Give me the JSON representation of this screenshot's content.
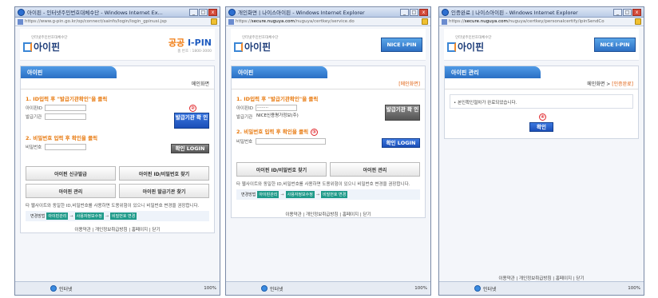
{
  "windows": [
    {
      "title": "아이핀 - 인터넷주민번호대체수단 - Windows Internet Ex...",
      "address": "https://www.g-pin.go.kr/op/connect/sainfo/login/login_gpinusi.jsp",
      "logo_org": "인터넷주민번호대체수단",
      "logo_text": "아이핀",
      "brand_title": "공공",
      "brand_title2": "I-PIN",
      "brand_sub": "홈 번호 : 1800-3000",
      "panel_title": "아이핀",
      "subtitle": "메인화면",
      "step1": "1. ID입력 후 \"발급기관확인\"을 클릭",
      "step1_num": "②",
      "id_label": "아이핀ID",
      "issuer_label": "발급기관",
      "btn_issuer": "발급기관 확 인",
      "step2": "2. 비밀번호 입력 후 확인을 클릭",
      "pw_label": "비밀번호",
      "btn_login": "확인 LOGIN",
      "menu": [
        "아이핀 신규발급",
        "아이핀 ID/비밀번호 찾기",
        "아이핀 관리",
        "아이핀 발급기관 찾기"
      ],
      "note": "타 웹사이트와 동일한 ID,비밀번호를 사용하면 도용위험이 있으니 비밀번호 변경을 권장합니다.",
      "flow_label": "변경방법",
      "flow": [
        "아이핀관리",
        "사용자정보수정",
        "비밀번호 변경"
      ],
      "footer": "이용약관  |  개인정보취급방침  |  홈페이지  |  닫기",
      "status": "인터넷",
      "zoom": "100%"
    },
    {
      "title": "개인화면 | 나이스아이핀 - Windows Internet Explorer",
      "address": "https://",
      "address_bold": "secure.nuguya.com",
      "address_rest": "/nuguya/certkey/service.do",
      "logo_org": "인터넷주민번호대체수단",
      "logo_text": "아이핀",
      "badge": "NICE I-PIN",
      "panel_title": "아이핀",
      "subtitle": "[메인화면]",
      "step1": "1. ID입력 후 \"발급기관확인\"을 클릭",
      "id_label": "아이핀ID",
      "id_value": "········",
      "issuer_label": "발급기관",
      "issuer_value": "NICE신용평가정보(주)",
      "btn_issuer": "발급기관 확 인",
      "step2": "2. 비밀번호 입력 후 확인을 클릭",
      "step2_num": "③",
      "pw_label": "비밀번호",
      "btn_login": "확인 LOGIN",
      "menu": [
        "아이핀 ID/비밀번호 찾기",
        "아이핀 관리"
      ],
      "note": "타 웹사이트와 동일한 ID,비밀번호를 사용하면 도용위험이 있으니 비밀번호 변경을 권장합니다.",
      "flow_label": "변경방법",
      "flow": [
        "아이핀관리",
        "사용자정보수정",
        "비밀번호 변경"
      ],
      "footer": "이용약관  |  개인정보취급방침  |  홈페이지  |  닫기",
      "status": "인터넷",
      "zoom": "100%"
    },
    {
      "title": "인증완료 | 나이스아이핀 - Windows Internet Explorer",
      "address": "https://",
      "address_bold": "secure.nuguya.com",
      "address_rest": "/nuguya/certkey/personalcertify/ipinSendCo",
      "logo_org": "인터넷주민번호대체수단",
      "logo_text": "아이핀",
      "badge": "NICE I-PIN",
      "panel_title": "아이핀 관리",
      "subtitle_a": "메인화면 >",
      "subtitle_b": "[인증완료]",
      "message": "• 본인확인절차가 완료되었습니다.",
      "step_num": "④",
      "btn_confirm": "확인",
      "footer": "이용약관  |  개인정보취급방침  |  홈페이지  |  닫기",
      "status": "인터넷",
      "zoom": "100%"
    }
  ]
}
